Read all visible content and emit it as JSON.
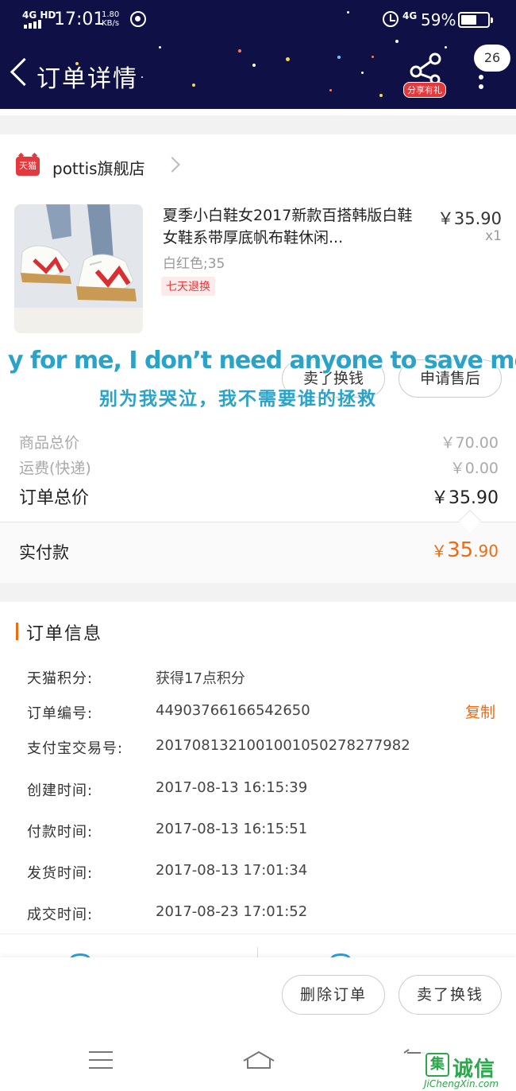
{
  "status_bar": {
    "network": "4G HD",
    "time": "17:01",
    "speed_value": "1.80",
    "speed_unit": "KB/s",
    "network_right": "4G",
    "battery": "59%",
    "battery_level": 0.59
  },
  "header": {
    "title": "订单详情",
    "share_badge": "分享有礼",
    "message_count": "26"
  },
  "shop": {
    "badge": "天猫",
    "name": "pottis旗舰店"
  },
  "product": {
    "title": "夏季小白鞋女2017新款百搭韩版白鞋女鞋系带厚底帆布鞋休闲...",
    "price": "￥35.90",
    "quantity": "x1",
    "sku": "白红色;35",
    "tag": "七天退换"
  },
  "overlay": {
    "english": "y for me, I don’t need anyone to save me",
    "chinese": "别为我哭泣，我不需要谁的拯救"
  },
  "item_actions": {
    "sell": "卖了换钱",
    "aftersale": "申请售后"
  },
  "summary": {
    "goods_label": "商品总价",
    "goods_value": "￥70.00",
    "shipping_label": "运费(快递)",
    "shipping_value": "￥0.00",
    "total_label": "订单总价",
    "total_value": "￥35.90",
    "paid_label": "实付款",
    "paid_currency": "￥",
    "paid_int": "35",
    "paid_dec": ".90"
  },
  "order_info": {
    "title": "订单信息",
    "copy": "复制",
    "rows": [
      {
        "key": "天猫积分:",
        "value": "获得17点积分"
      },
      {
        "key": "订单编号:",
        "value": "44903766166542650"
      },
      {
        "key": "支付宝交易号:",
        "value": "2017081321001001050278277982"
      },
      {
        "key": "创建时间:",
        "value": "2017-08-13 16:15:39"
      },
      {
        "key": "付款时间:",
        "value": "2017-08-13 16:15:51"
      },
      {
        "key": "发货时间:",
        "value": "2017-08-13 17:01:34"
      },
      {
        "key": "成交时间:",
        "value": "2017-08-23 17:01:52"
      }
    ]
  },
  "bottom_actions": {
    "delete": "删除订单",
    "sell": "卖了换钱"
  },
  "watermark": {
    "logo": "集",
    "text": "诚信",
    "url": "JiChengXin.com"
  },
  "colors": {
    "header_bg": "#0f1146",
    "accent": "#f06a0f",
    "tmall_red": "#e4393c",
    "caption": "#2aa3c8"
  }
}
